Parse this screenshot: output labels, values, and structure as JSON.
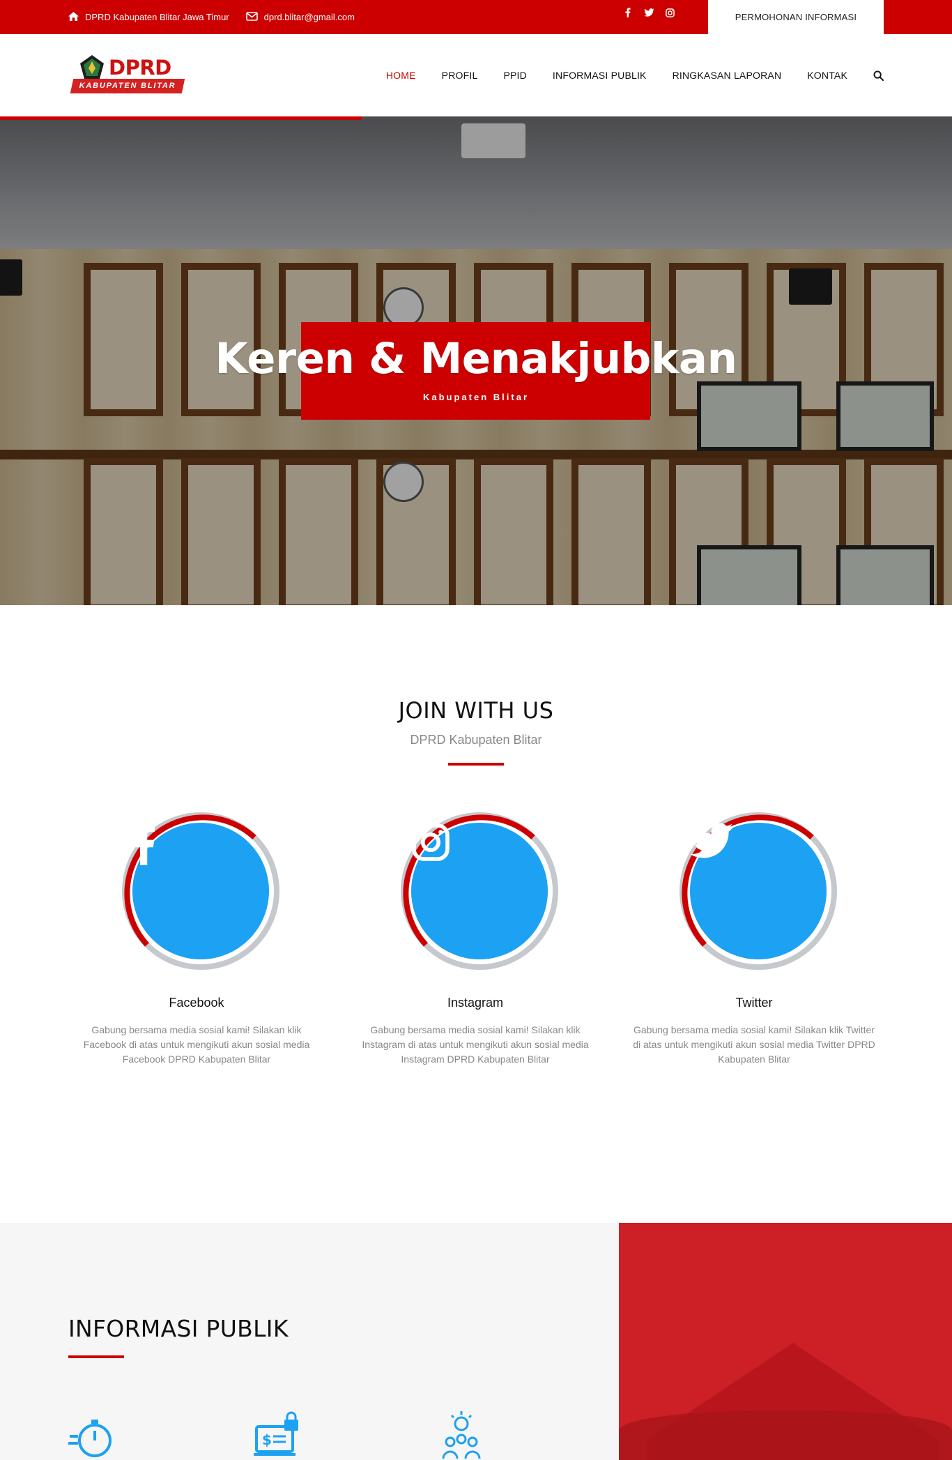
{
  "topbar": {
    "address": "DPRD Kabupaten Blitar Jawa Timur",
    "email": "dprd.blitar@gmail.com",
    "cta": "PERMOHONAN INFORMASI",
    "social_icons": [
      "facebook-icon",
      "twitter-icon",
      "instagram-icon"
    ]
  },
  "logo": {
    "brand": "DPRD",
    "tagline": "KABUPATEN BLITAR"
  },
  "nav": {
    "items": [
      {
        "label": "HOME",
        "active": true
      },
      {
        "label": "PROFIL",
        "active": false
      },
      {
        "label": "PPID",
        "active": false
      },
      {
        "label": "INFORMASI PUBLIK",
        "active": false
      },
      {
        "label": "RINGKASAN LAPORAN",
        "active": false
      },
      {
        "label": "KONTAK",
        "active": false
      }
    ],
    "search_icon": "search-icon"
  },
  "hero": {
    "title": "Keren & Menakjubkan",
    "subtitle": "Kabupaten Blitar",
    "slide_progress": 0.38
  },
  "join": {
    "title": "JOIN WITH US",
    "subtitle": "DPRD Kabupaten Blitar",
    "cards": [
      {
        "name": "Facebook",
        "icon": "facebook-icon",
        "description": "Gabung bersama media sosial kami! Silakan klik Facebook di atas untuk mengikuti akun sosial media Facebook DPRD Kabupaten Blitar"
      },
      {
        "name": "Instagram",
        "icon": "instagram-icon",
        "description": "Gabung bersama media sosial kami! Silakan klik Instagram di atas untuk mengikuti akun sosial media Instagram DPRD Kabupaten Blitar"
      },
      {
        "name": "Twitter",
        "icon": "twitter-icon",
        "description": "Gabung bersama media sosial kami! Silakan klik Twitter di atas untuk mengikuti akun sosial media Twitter DPRD Kabupaten Blitar"
      }
    ]
  },
  "info": {
    "title": "INFORMASI PUBLIK",
    "icons": [
      "stopwatch-icon",
      "laptop-payment-lock-icon",
      "idea-team-icon"
    ]
  },
  "colors": {
    "brand_red": "#cc0000",
    "social_blue": "#1da1f2",
    "ring_gray": "#c5c8cc"
  }
}
